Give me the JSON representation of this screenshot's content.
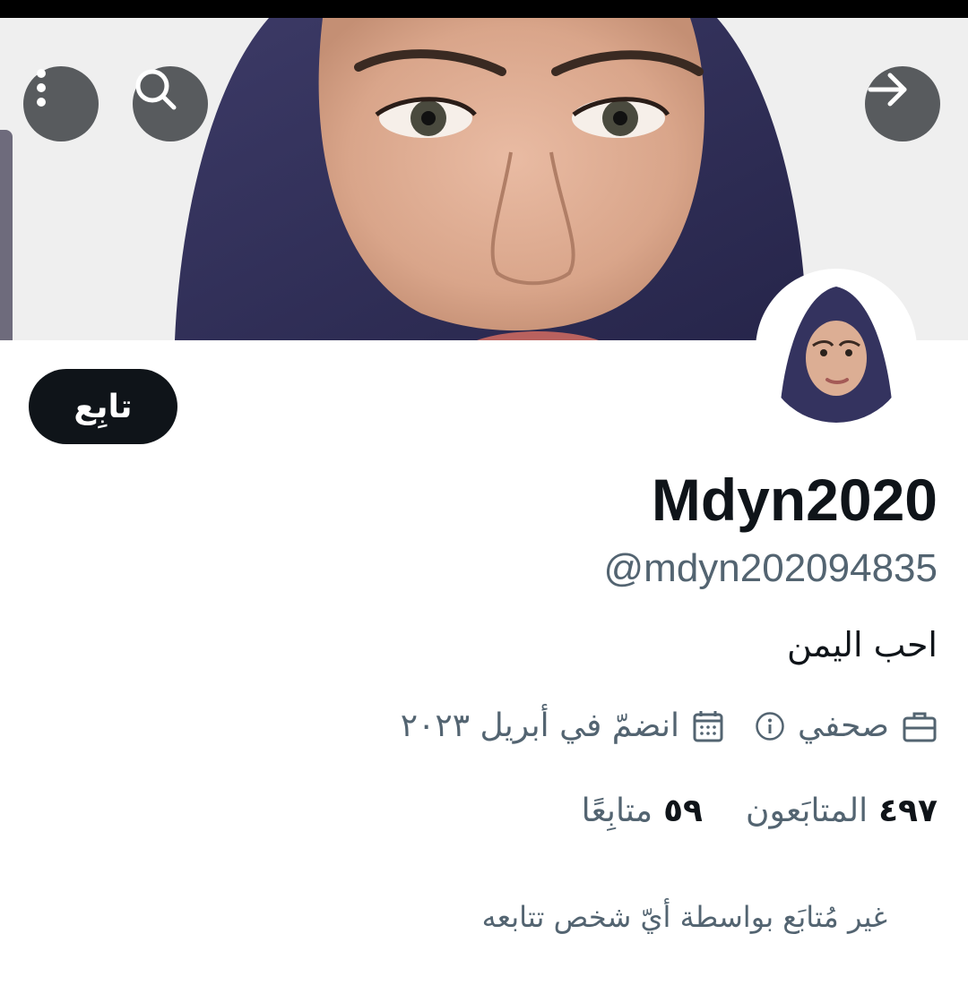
{
  "header": {
    "more_icon": "more-vertical-icon",
    "search_icon": "search-icon",
    "back_icon": "arrow-right-icon"
  },
  "profile": {
    "follow_label": "تابِع",
    "display_name": "Mdyn2020",
    "handle": "@mdyn202094835",
    "bio": "احب اليمن",
    "profession": "صحفي",
    "joined": "انضمّ في أبريل ٢٠٢٣",
    "followers_count": "٤٩٧",
    "followers_label": "المتابَعون",
    "following_count": "٥٩",
    "following_label": "متابِعًا",
    "not_followed_text": "غير مُتابَع بواسطة أيّ شخص تتابعه"
  },
  "colors": {
    "primary_text": "#0f1419",
    "secondary_text": "#536471",
    "follow_button_bg": "#0f1419"
  }
}
